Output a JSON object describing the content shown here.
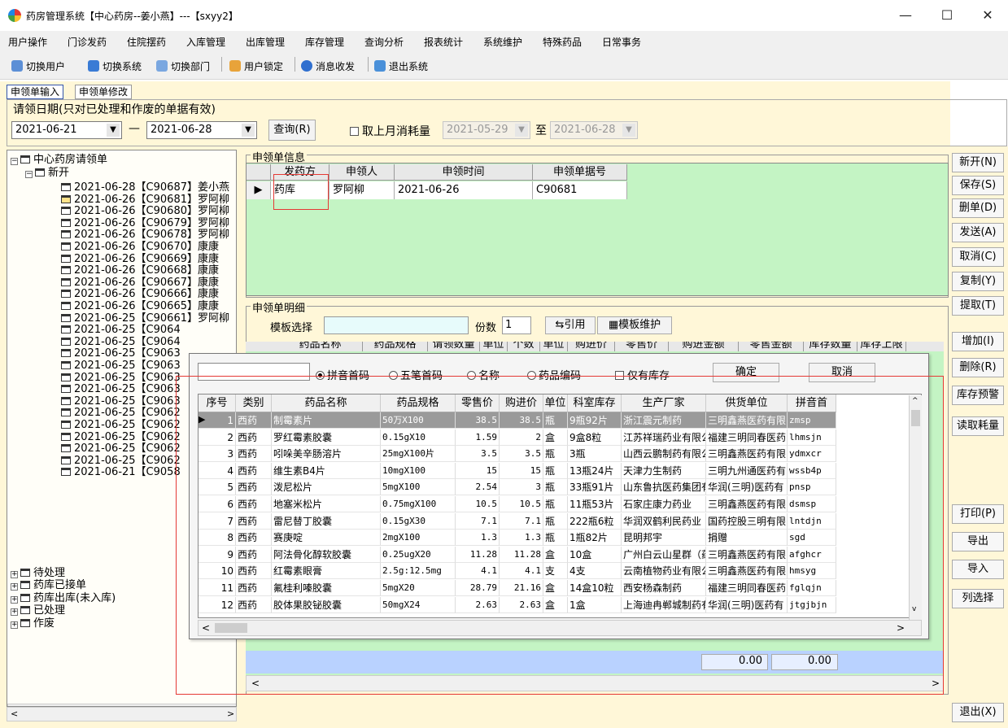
{
  "window": {
    "title": "药房管理系统【中心药房--姜小燕】---【sxyy2】",
    "minimize": "—",
    "maximize": "☐",
    "close": "✕"
  },
  "menu": [
    "用户操作",
    "门诊发药",
    "住院摆药",
    "入库管理",
    "出库管理",
    "库存管理",
    "查询分析",
    "报表统计",
    "系统维护",
    "特殊药品",
    "日常事务"
  ],
  "toolbar": {
    "switch_user": "切换用户",
    "switch_system": "切换系统",
    "switch_dept": "切换部门",
    "user_lock": "用户锁定",
    "messages": "消息收发",
    "exit": "退出系统"
  },
  "tabs": [
    "申领单输入",
    "申领单修改"
  ],
  "date_filter": {
    "legend": "请领日期(只对已处理和作废的单据有效)",
    "from": "2021-06-21",
    "dash": "—",
    "to": "2021-06-28",
    "query": "查询(R)",
    "last_month_label": "取上月消耗量",
    "lm_from": "2021-05-29",
    "lm_to_label": "至",
    "lm_to": "2021-06-28"
  },
  "tree": {
    "root": "中心药房请领单",
    "new_group": "新开",
    "items": [
      "2021-06-28【C90687】姜小燕",
      "2021-06-26【C90681】罗阿柳",
      "2021-06-26【C90680】罗阿柳",
      "2021-06-26【C90679】罗阿柳",
      "2021-06-26【C90678】罗阿柳",
      "2021-06-26【C90670】康康",
      "2021-06-26【C90669】康康",
      "2021-06-26【C90668】康康",
      "2021-06-26【C90667】康康",
      "2021-06-26【C90666】康康",
      "2021-06-26【C90665】康康",
      "2021-06-25【C90661】罗阿柳",
      "2021-06-25【C9064",
      "2021-06-25【C9064",
      "2021-06-25【C9063",
      "2021-06-25【C9063",
      "2021-06-25【C9063",
      "2021-06-25【C9063",
      "2021-06-25【C9063",
      "2021-06-25【C9062",
      "2021-06-25【C9062",
      "2021-06-25【C9062",
      "2021-06-25【C9062",
      "2021-06-25【C9062",
      "2021-06-21【C9058"
    ],
    "groups": [
      "待处理",
      "药库已接单",
      "药库出库(未入库)",
      "已处理",
      "作废"
    ]
  },
  "info": {
    "legend": "申领单信息",
    "columns": [
      "发药方",
      "申领人",
      "申领时间",
      "申领单据号"
    ],
    "row": [
      "药库",
      "罗阿柳",
      "2021-06-26",
      "C90681"
    ]
  },
  "detail": {
    "legend": "申领单明细",
    "template_label": "模板选择",
    "copies_label": "份数",
    "copies_value": "1",
    "cite_btn": "引用",
    "tmpl_btn": "模板维护",
    "header_partial": [
      "药品名称",
      "药品规格",
      "请领数量",
      "单位",
      "个数",
      "单位",
      "购进价",
      "零售价",
      "购进金额",
      "零售金额",
      "库存数量",
      "库存上限"
    ],
    "total_purchase": "0.00",
    "total_retail": "0.00"
  },
  "popup": {
    "search_value": "",
    "radios": [
      "拼音首码",
      "五笔首码",
      "名称",
      "药品编码"
    ],
    "stock_only": "仅有库存",
    "ok": "确定",
    "cancel": "取消",
    "columns": [
      "序号",
      "类别",
      "药品名称",
      "药品规格",
      "零售价",
      "购进价",
      "单位",
      "科室库存",
      "生产厂家",
      "供货单位",
      "拼音首"
    ],
    "rows": [
      [
        "1",
        "西药",
        "制霉素片",
        "50万X100",
        "38.5",
        "38.5",
        "瓶",
        "9瓶92片",
        "浙江震元制药",
        "三明鑫燕医药有限",
        "zmsp"
      ],
      [
        "2",
        "西药",
        "罗红霉素胶囊",
        "0.15gX10",
        "1.59",
        "2",
        "盒",
        "9盒8粒",
        "江苏祥瑞药业有限公",
        "福建三明同春医药",
        "lhmsjn"
      ],
      [
        "3",
        "西药",
        "吲哚美辛肠溶片",
        "25mgX100片",
        "3.5",
        "3.5",
        "瓶",
        "3瓶",
        "山西云鹏制药有限公",
        "三明鑫燕医药有限",
        "ydmxcr"
      ],
      [
        "4",
        "西药",
        "维生素B4片",
        "10mgX100",
        "15",
        "15",
        "瓶",
        "13瓶24片",
        "天津力生制药",
        "三明九州通医药有",
        "wssb4p"
      ],
      [
        "5",
        "西药",
        "泼尼松片",
        "5mgX100",
        "2.54",
        "3",
        "瓶",
        "33瓶91片",
        "山东鲁抗医药集团有",
        "华润(三明)医药有",
        "pnsp"
      ],
      [
        "6",
        "西药",
        "地塞米松片",
        "0.75mgX100",
        "10.5",
        "10.5",
        "瓶",
        "11瓶53片",
        "石家庄康力药业",
        "三明鑫燕医药有限",
        "dsmsp"
      ],
      [
        "7",
        "西药",
        "雷尼替丁胶囊",
        "0.15gX30",
        "7.1",
        "7.1",
        "瓶",
        "222瓶6粒",
        "华润双鹤利民药业",
        "国药控股三明有限",
        "lntdjn"
      ],
      [
        "8",
        "西药",
        "赛庚啶",
        "2mgX100",
        "1.3",
        "1.3",
        "瓶",
        "1瓶82片",
        "昆明邦宇",
        "捐赠",
        "sgd"
      ],
      [
        "9",
        "西药",
        "阿法骨化醇软胶囊",
        "0.25ugX20",
        "11.28",
        "11.28",
        "盒",
        "10盒",
        "广州白云山星群（药",
        "三明鑫燕医药有限",
        "afghcr"
      ],
      [
        "10",
        "西药",
        "红霉素眼膏",
        "2.5g:12.5mg",
        "4.1",
        "4.1",
        "支",
        "4支",
        "云南植物药业有限公",
        "三明鑫燕医药有限",
        "hmsyg"
      ],
      [
        "11",
        "西药",
        "氟桂利嗪胶囊",
        "5mgX20",
        "28.79",
        "21.16",
        "盒",
        "14盒10粒",
        "西安杨森制药",
        "福建三明同春医药",
        "fglqjn"
      ],
      [
        "12",
        "西药",
        "胶体果胶铋胶囊",
        "50mgX24",
        "2.63",
        "2.63",
        "盒",
        "1盒",
        "上海迪冉郸城制药有",
        "华润(三明)医药有",
        "jtgjbjn"
      ]
    ]
  },
  "right_buttons": [
    "新开(N)",
    "保存(S)",
    "删单(D)",
    "发送(A)",
    "取消(C)",
    "复制(Y)",
    "提取(T)",
    "增加(I)",
    "删除(R)",
    "库存预警",
    "读取耗量",
    "打印(P)",
    "导出",
    "导入",
    "列选择",
    "退出(X)"
  ],
  "colors": {
    "panel_bg": "#fff7d8",
    "grid_bg": "#c4f4c4",
    "selected_row": "#9a9a9a",
    "highlight": "#e53935"
  }
}
